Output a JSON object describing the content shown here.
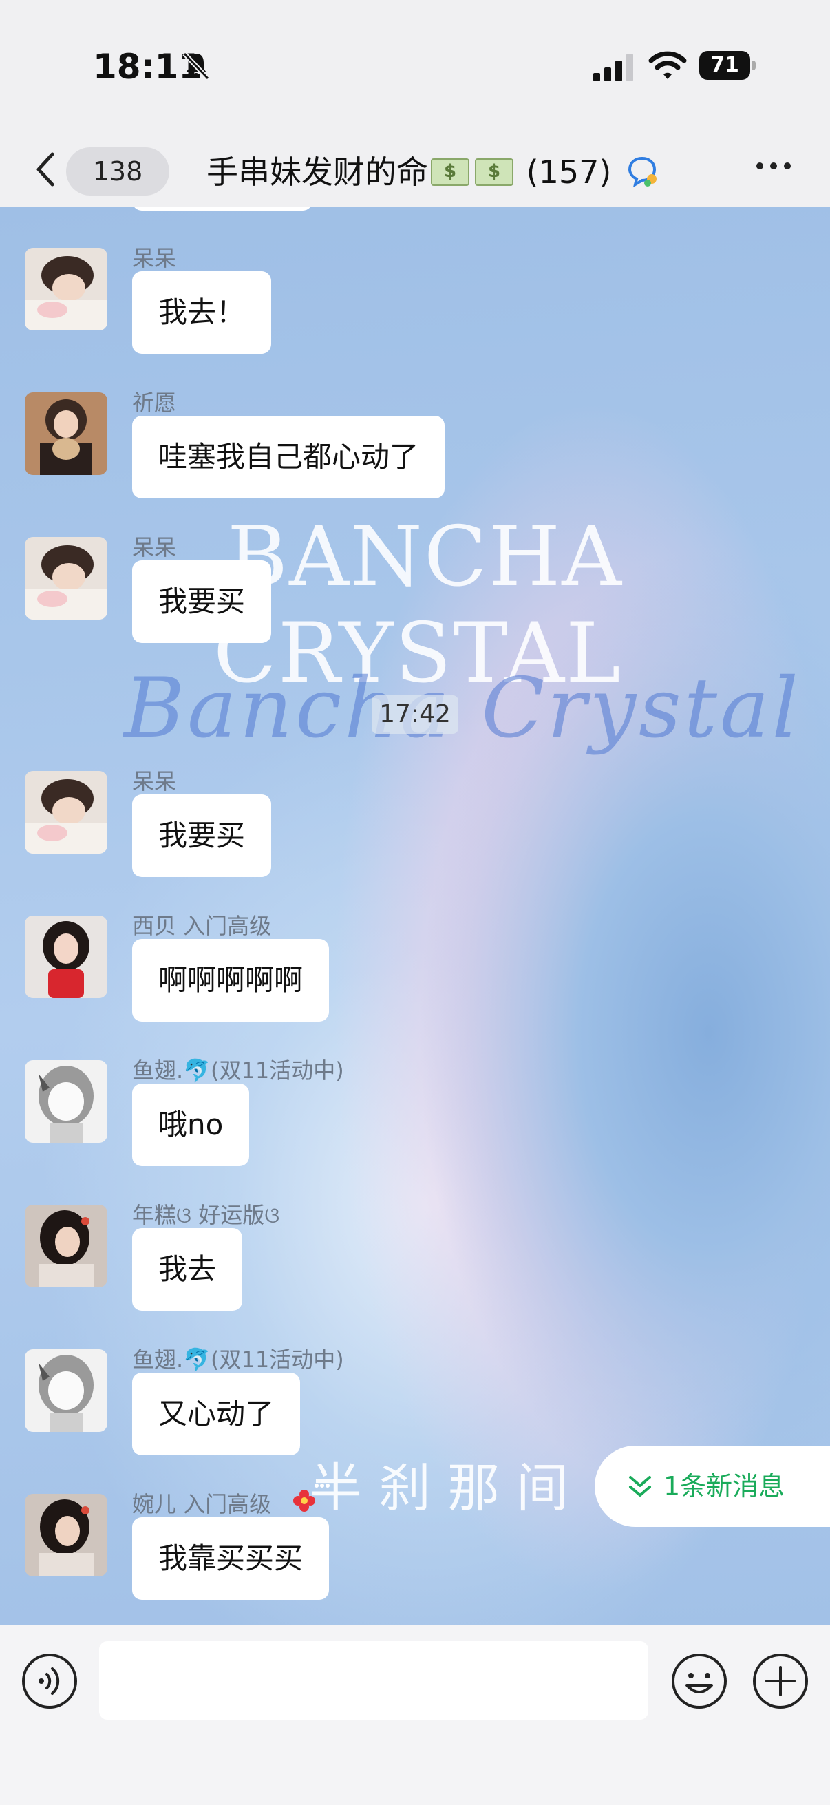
{
  "status_bar": {
    "time": "18:11",
    "battery": "71",
    "icons": [
      "bell-slash-icon",
      "cellular-signal-icon",
      "wifi-icon",
      "battery-icon"
    ]
  },
  "nav": {
    "unread_count": "138",
    "title": "手串妹发财的命",
    "member_count": "(157)",
    "icons": [
      "back-chevron-icon",
      "money-emoji-icon",
      "group-chat-icon",
      "more-icon"
    ]
  },
  "wallpaper_text": {
    "line1": "BANCHA",
    "line2": "CRYSTAL",
    "script": "Bancha Crystal",
    "bottom": "半刹那间"
  },
  "timestamp": "17:42",
  "messages": [
    {
      "sender": "呆呆",
      "text": "我去！",
      "avatar": "girl-lying-avatar"
    },
    {
      "sender": "祈愿",
      "text": "哇塞我自己都心动了",
      "avatar": "girl-holding-cat-avatar"
    },
    {
      "sender": "呆呆",
      "text": "我要买",
      "avatar": "girl-lying-avatar"
    },
    {
      "sender": "呆呆",
      "text": "我要买",
      "avatar": "girl-lying-avatar"
    },
    {
      "sender": "西贝 入门高级",
      "text": "啊啊啊啊啊",
      "avatar": "girl-red-dress-avatar"
    },
    {
      "sender": "鱼翅.🐬(双11活动中)",
      "text": "哦no",
      "avatar": "anime-girl-avatar"
    },
    {
      "sender": "年糕ଓ 好运版ଓ",
      "text": "我去",
      "avatar": "girl-dark-hair-avatar"
    },
    {
      "sender": "鱼翅.🐬(双11活动中)",
      "text": "又心动了",
      "avatar": "anime-girl-avatar"
    },
    {
      "sender": "婉儿 入门高级",
      "text": "我靠买买买",
      "avatar": "girl-dark-hair-avatar"
    }
  ],
  "new_message_pill": "1条新消息",
  "input": {
    "placeholder": "",
    "value": ""
  },
  "colors": {
    "accent_green": "#1aab5a",
    "bubble": "#ffffff",
    "bar": "#f0f0f2"
  }
}
